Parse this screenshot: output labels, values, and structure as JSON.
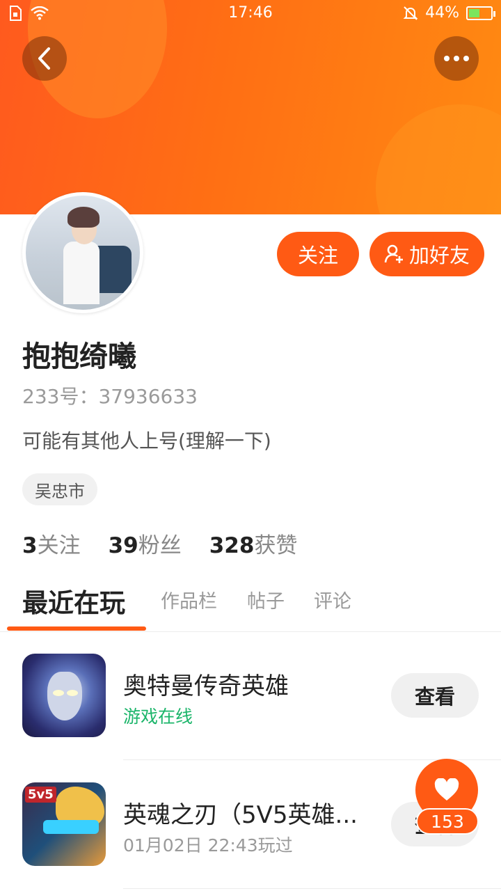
{
  "status_bar": {
    "time": "17:46",
    "battery": "44%"
  },
  "header": {
    "back_icon": "chevron-left-icon",
    "more_icon": "more-dots-icon"
  },
  "actions": {
    "follow_label": "关注",
    "add_friend_label": "加好友"
  },
  "profile": {
    "name": "抱抱绮曦",
    "uid": "233号：37936633",
    "bio": "可能有其他人上号(理解一下)",
    "location_tag": "吴忠市"
  },
  "stats": [
    {
      "value": "3",
      "label": "关注"
    },
    {
      "value": "39",
      "label": "粉丝"
    },
    {
      "value": "328",
      "label": "获赞"
    }
  ],
  "tabs": [
    {
      "label": "最近在玩",
      "active": true
    },
    {
      "label": "作品栏",
      "active": false
    },
    {
      "label": "帖子",
      "active": false
    },
    {
      "label": "评论",
      "active": false
    }
  ],
  "games": [
    {
      "title": "奥特曼传奇英雄",
      "subtitle": "游戏在线",
      "subtitle_color": "#1bb56a",
      "button": "查看"
    },
    {
      "title": "英魂之刃（5V5英雄...",
      "subtitle": "01月02日 22:43玩过",
      "subtitle_color": "#9a9a9a",
      "button": "查看"
    }
  ],
  "like": {
    "count": "153",
    "icon": "heart-icon"
  },
  "colors": {
    "accent": "#ff5a14",
    "online_green": "#1bb56a"
  }
}
